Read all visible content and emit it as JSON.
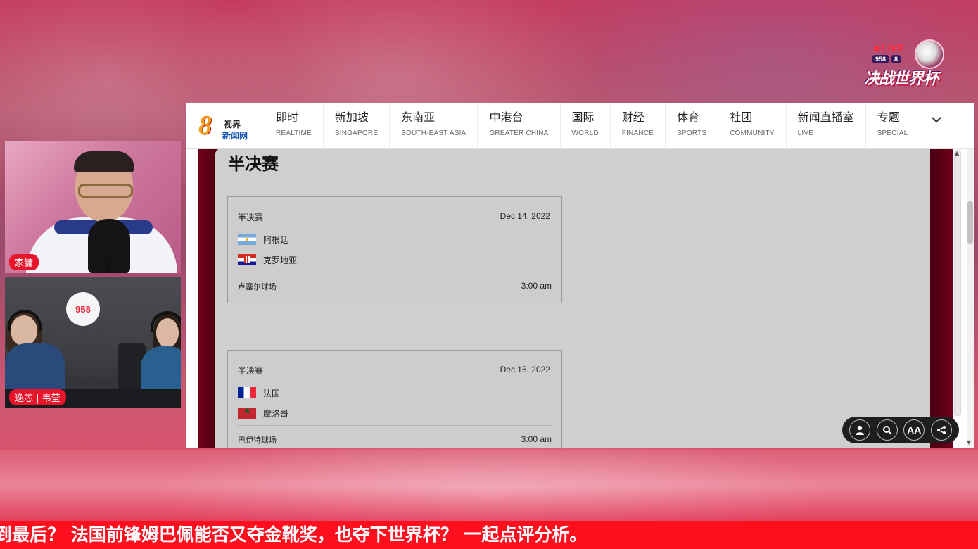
{
  "overlay": {
    "live_label": "LIVE",
    "live_badge_1": "958",
    "live_badge_2": "8",
    "live_title": "决战世界杯",
    "cam1_label": "家镛",
    "cam2_label": "逸芯 | 韦莹",
    "studio_logo": "958",
    "ticker": "到最后？ 法国前锋姆巴佩能否又夺金靴奖，也夺下世界杯？ 一起点评分析。"
  },
  "site": {
    "brand_line1": "视界",
    "brand_line2": "新闻网",
    "nav": [
      {
        "zh": "即时",
        "en": "REALTIME"
      },
      {
        "zh": "新加坡",
        "en": "SINGAPORE"
      },
      {
        "zh": "东南亚",
        "en": "SOUTH-EAST ASIA"
      },
      {
        "zh": "中港台",
        "en": "GREATER CHINA"
      },
      {
        "zh": "国际",
        "en": "WORLD"
      },
      {
        "zh": "财经",
        "en": "FINANCE"
      },
      {
        "zh": "体育",
        "en": "SPORTS"
      },
      {
        "zh": "社团",
        "en": "COMMUNITY"
      },
      {
        "zh": "新闻直播室",
        "en": "LIVE"
      },
      {
        "zh": "专题",
        "en": "SPECIAL"
      }
    ]
  },
  "content": {
    "section_title": "半决赛",
    "matches": [
      {
        "round": "半决赛",
        "date": "Dec 14, 2022",
        "team1": "阿根廷",
        "team2": "克罗地亚",
        "venue": "卢塞尔球场",
        "time": "3:00 am"
      },
      {
        "round": "半决赛",
        "date": "Dec 15, 2022",
        "team1": "法国",
        "team2": "摩洛哥",
        "venue": "巴伊特球场",
        "time": "3:00 am"
      }
    ]
  },
  "toolbar": {
    "font_size_label": "AA"
  },
  "colors": {
    "ticker_bg": "#ff0e1e",
    "label_bg": "#e8142a",
    "brand_blue": "#1a58b8",
    "brand_gold": "#f0a01c"
  }
}
